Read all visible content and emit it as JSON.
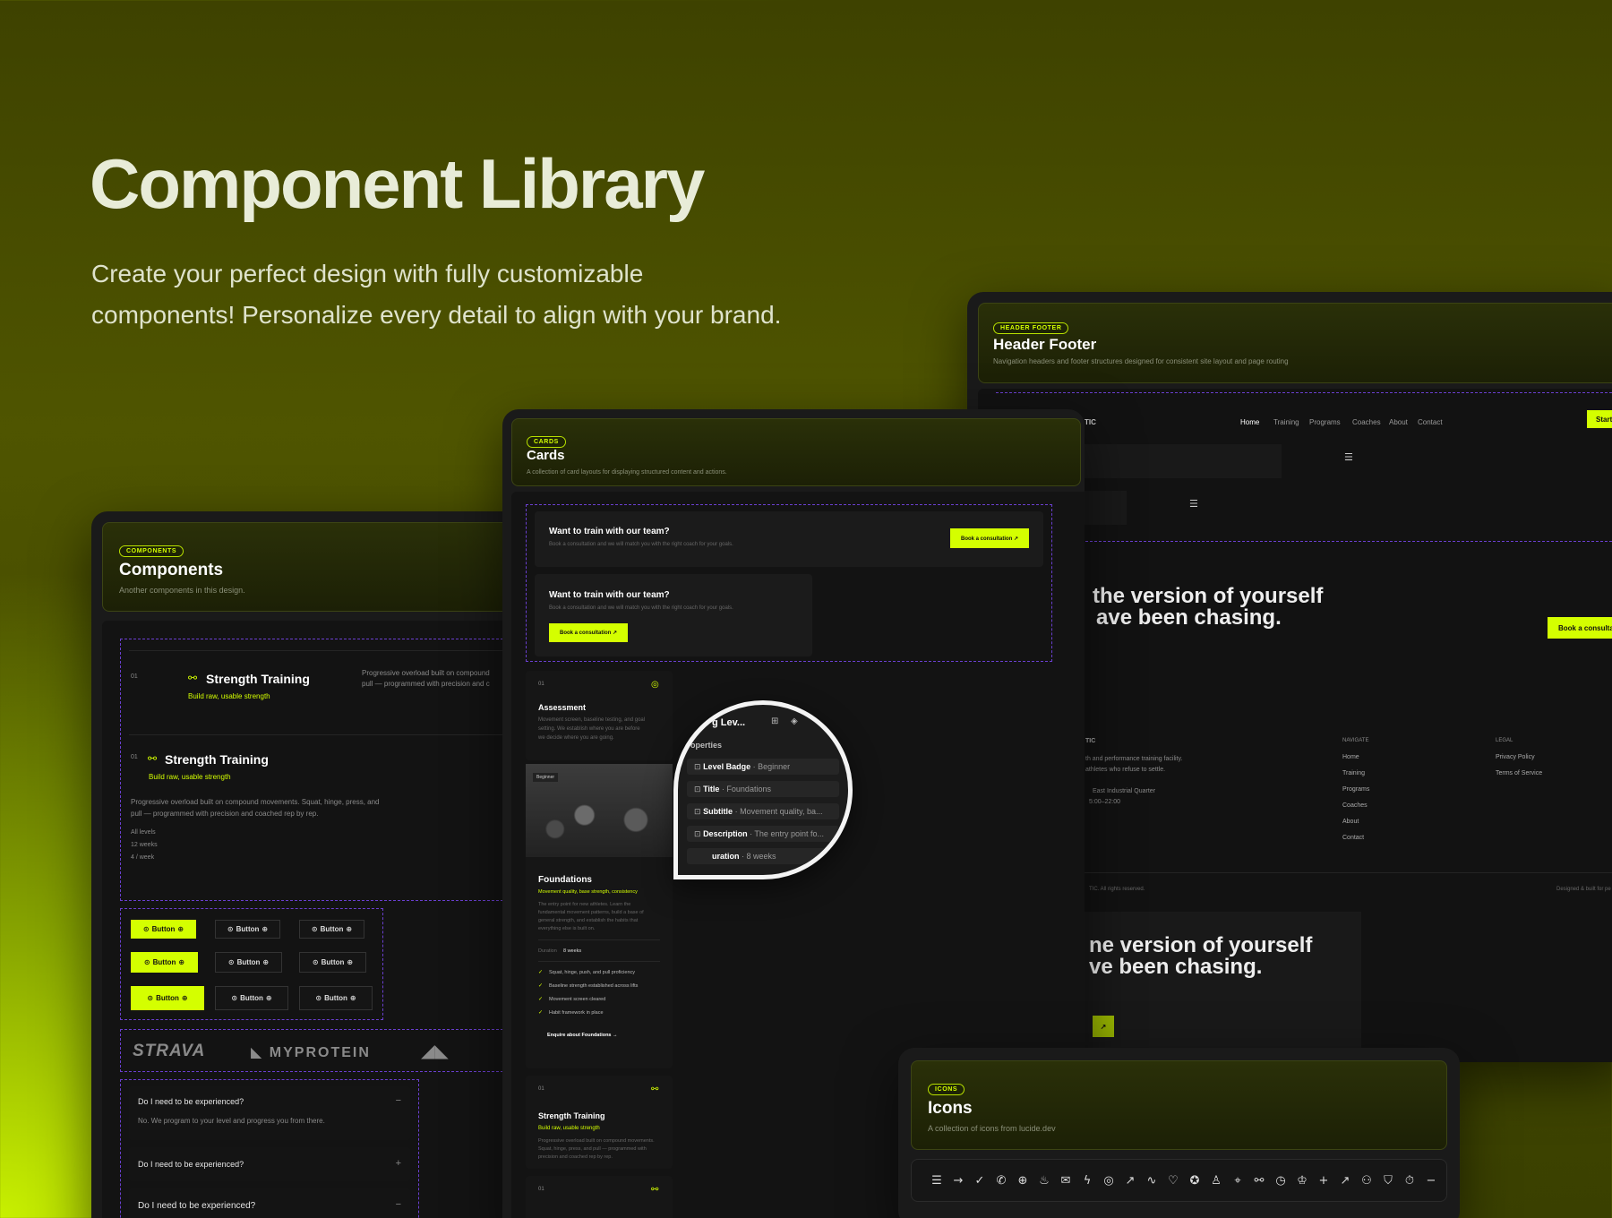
{
  "hero": {
    "title": "Component Library",
    "subtitle_line1": "Create your perfect design with fully customizable",
    "subtitle_line2": "components! Personalize every detail to align with your brand."
  },
  "components_panel": {
    "badge": "COMPONENTS",
    "title": "Components",
    "description": "Another components in this design.",
    "feature1": {
      "index": "01",
      "title": "Strength Training",
      "subtitle": "Build raw, usable strength",
      "desc": "Progressive overload built on compound",
      "desc2": "pull — programmed with precision and c"
    },
    "feature2": {
      "index": "01",
      "title": "Strength Training",
      "subtitle": "Build raw, usable strength",
      "desc1": "Progressive overload built on compound movements. Squat, hinge, press, and",
      "desc2": "pull — programmed with precision and coached rep by rep.",
      "meta": [
        "All levels",
        "12 weeks",
        "4 / week"
      ]
    },
    "buttons": [
      [
        "Button",
        "Button",
        "Button"
      ],
      [
        "Button",
        "Button",
        "Button"
      ],
      [
        "Button",
        "Button",
        "Button"
      ]
    ],
    "logos": [
      "STRAVA",
      "MYPROTEIN"
    ],
    "faq": [
      {
        "q": "Do I need to be experienced?",
        "a": "No. We program to your level and progress you from there.",
        "sign": "−"
      },
      {
        "q": "Do I need to be experienced?",
        "sign": "+"
      },
      {
        "q": "Do I need to be experienced?",
        "sign": "−"
      }
    ]
  },
  "cards_panel": {
    "badge": "CARDS",
    "title": "Cards",
    "description": "A collection of card layouts for displaying structured content and actions.",
    "cta1": {
      "title": "Want to train with our team?",
      "desc": "Book a consultation and we will match you with the right coach for your goals.",
      "button": "Book a consultation ↗"
    },
    "cta2": {
      "title": "Want to train with our team?",
      "desc": "Book a consultation and we will match you with the right coach for your goals.",
      "button": "Book a consultation ↗"
    },
    "assessment": {
      "index": "01",
      "title": "Assessment",
      "desc": [
        "Movement screen, baseline testing, and goal",
        "setting. We establish where you are before",
        "we decide where you are going."
      ]
    },
    "program": {
      "badge": "Beginner",
      "title": "Foundations",
      "subtitle": "Movement quality, base strength, consistency",
      "desc": [
        "The entry point for new athletes. Learn the",
        "fundamental movement patterns, build a base of",
        "general strength, and establish the habits that",
        "everything else is built on."
      ],
      "duration_label": "Duration",
      "duration": "8 weeks",
      "bullets": [
        "Squat, hinge, push, and pull proficiency",
        "Baseline strength established across lifts",
        "Movement screen cleared",
        "Habit framework in place"
      ],
      "link": "Enquire about Foundations →"
    },
    "feature": {
      "index": "01",
      "title": "Strength Training",
      "subtitle": "Build raw, usable strength",
      "desc": [
        "Progressive overload built on compound movements.",
        "Squat, hinge, press, and pull — programmed with",
        "precision and coached rep by rep."
      ]
    },
    "feature_b_index": "01"
  },
  "magnifier": {
    "title": "g Lev...",
    "section": "operties",
    "rows": [
      {
        "label": "Level Badge",
        "value": "· Beginner"
      },
      {
        "label": "Title",
        "value": "· Foundations"
      },
      {
        "label": "Subtitle",
        "value": "· Movement quality, ba..."
      },
      {
        "label": "Description",
        "value": "· The entry point fo..."
      },
      {
        "label": "uration",
        "value": "· 8 weeks"
      }
    ]
  },
  "header_footer_panel": {
    "badge": "HEADER FOOTER",
    "title": "Header Footer",
    "description": "Navigation headers and footer structures designed for consistent site layout and page routing",
    "brand": "TIC",
    "nav": [
      "Home",
      "Training",
      "Programs",
      "Coaches",
      "About",
      "Contact"
    ],
    "nav_cta": "Start t",
    "hero_line1": "the version of yourself",
    "hero_line2": "ave been chasing.",
    "hero_cta": "Book a consultati",
    "footer_brand": "TIC",
    "footer_tag1": "th and performance training facility.",
    "footer_tag2": "athletes who refuse to settle.",
    "footer_addr1": "East Industrial Quarter",
    "footer_addr2": "5:00–22:00",
    "navigate_heading": "NAVIGATE",
    "navigate": [
      "Home",
      "Training",
      "Programs",
      "Coaches",
      "About",
      "Contact"
    ],
    "legal_heading": "LEGAL",
    "legal": [
      "Privacy Policy",
      "Terms of Service"
    ],
    "copyright": "TIC. All rights reserved.",
    "designed": "Designed & built for pe",
    "hero2_line1": "ne version of yourself",
    "hero2_line2": "ve been chasing.",
    "hero2_btn": "↗"
  },
  "icons_panel": {
    "badge": "ICONS",
    "title": "Icons",
    "description": "A collection of icons from lucide.dev",
    "icons": [
      {
        "name": "menu-icon",
        "glyph": "☰"
      },
      {
        "name": "arrow-right-icon",
        "glyph": "→"
      },
      {
        "name": "check-icon",
        "glyph": "✓"
      },
      {
        "name": "phone-icon",
        "glyph": "✆"
      },
      {
        "name": "plus-circle-icon",
        "glyph": "⊕"
      },
      {
        "name": "flame-icon",
        "glyph": "♨"
      },
      {
        "name": "mail-icon",
        "glyph": "✉"
      },
      {
        "name": "zap-icon",
        "glyph": "ϟ"
      },
      {
        "name": "target-icon",
        "glyph": "◎"
      },
      {
        "name": "arrow-up-right-icon",
        "glyph": "↗"
      },
      {
        "name": "activity-icon",
        "glyph": "∿"
      },
      {
        "name": "heart-pulse-icon",
        "glyph": "♡"
      },
      {
        "name": "award-icon",
        "glyph": "✪"
      },
      {
        "name": "user-icon",
        "glyph": "♙"
      },
      {
        "name": "map-pin-icon",
        "glyph": "⌖"
      },
      {
        "name": "dumbbell-icon",
        "glyph": "⚯"
      },
      {
        "name": "clock-icon",
        "glyph": "◷"
      },
      {
        "name": "trophy-icon",
        "glyph": "♔"
      },
      {
        "name": "plus-icon",
        "glyph": "+"
      },
      {
        "name": "trending-up-icon",
        "glyph": "↗"
      },
      {
        "name": "users-icon",
        "glyph": "⚇"
      },
      {
        "name": "shield-icon",
        "glyph": "⛉"
      },
      {
        "name": "timer-icon",
        "glyph": "⏱"
      },
      {
        "name": "minus-icon",
        "glyph": "−"
      }
    ]
  },
  "colors": {
    "accent": "#d4ff00",
    "panel": "#1a1a1a",
    "dashed": "#6a3fd0"
  }
}
